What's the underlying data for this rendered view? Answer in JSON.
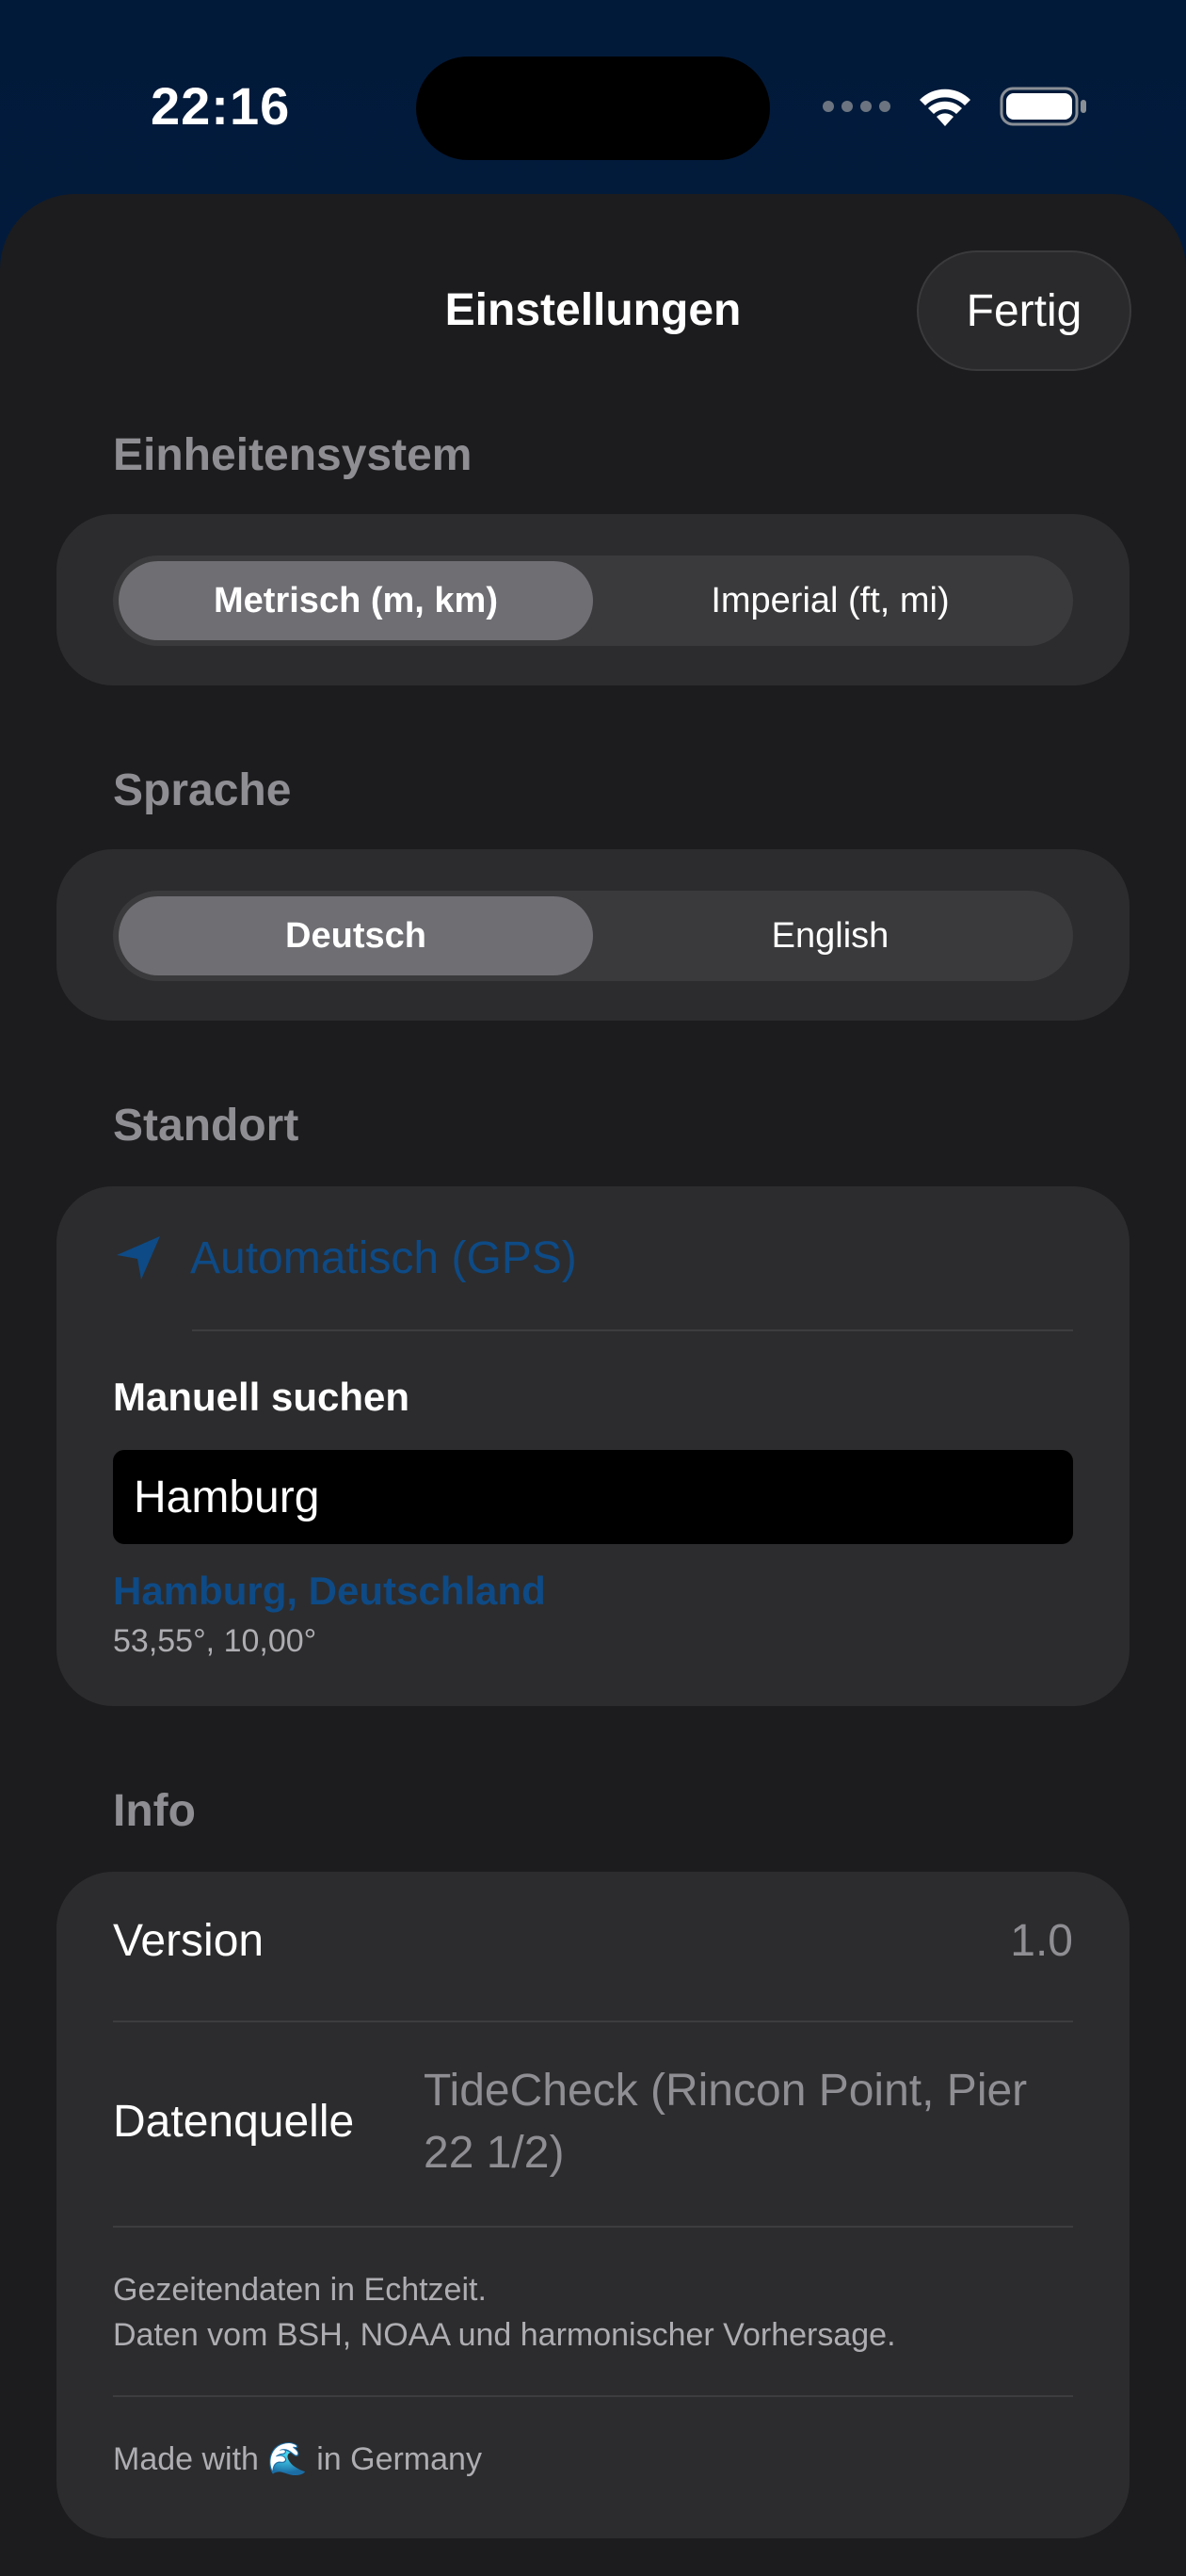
{
  "status_bar": {
    "time": "22:16"
  },
  "header": {
    "title": "Einstellungen",
    "done_label": "Fertig"
  },
  "units": {
    "section": "Einheitensystem",
    "options": [
      "Metrisch (m, km)",
      "Imperial (ft, mi)"
    ],
    "selected": "Metrisch (m, km)"
  },
  "language": {
    "section": "Sprache",
    "options": [
      "Deutsch",
      "English"
    ],
    "selected": "Deutsch"
  },
  "location": {
    "section": "Standort",
    "auto_label": "Automatisch (GPS)",
    "manual_label": "Manuell suchen",
    "search_value": "Hamburg",
    "result_name": "Hamburg, Deutschland",
    "result_coords": "53,55°, 10,00°"
  },
  "info": {
    "section": "Info",
    "version_label": "Version",
    "version_value": "1.0",
    "source_label": "Datenquelle",
    "source_value_line1": "TideCheck (Rincon Point, Pier",
    "source_value_line2": "22 1/2)",
    "note_line1": "Gezeitendaten in Echtzeit.",
    "note_line2": "Daten vom BSH, NOAA und harmonischer Vorhersage.",
    "footer_prefix": "Made with",
    "footer_emoji": "🌊",
    "footer_suffix": "in Germany"
  },
  "colors": {
    "accent_blue": "#0e4a85",
    "sheet_bg": "#1c1c1e",
    "card_bg": "#2c2c2e",
    "status_bg": "#021a3a"
  }
}
